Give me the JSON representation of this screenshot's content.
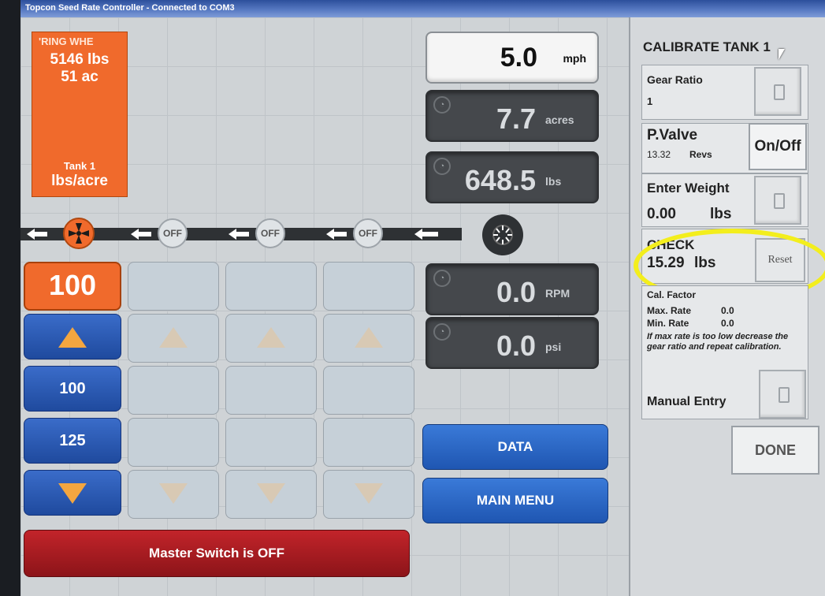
{
  "window": {
    "title": "Topcon Seed Rate Controller - Connected to COM3"
  },
  "tank": {
    "name": "'RING WHE",
    "weight": "5146 lbs",
    "area": "51 ac",
    "tank_label": "Tank 1",
    "unit": "lbs/acre"
  },
  "readouts": {
    "speed": {
      "value": "5.0",
      "unit": "mph"
    },
    "acres": {
      "value": "7.7",
      "unit": "acres"
    },
    "lbs": {
      "value": "648.5",
      "unit": "lbs"
    },
    "rpm": {
      "value": "0.0",
      "unit": "RPM"
    },
    "psi": {
      "value": "0.0",
      "unit": "psi"
    }
  },
  "sections": {
    "off_labels": [
      "OFF",
      "OFF",
      "OFF"
    ]
  },
  "rate": {
    "current": "100",
    "preset1": "100",
    "preset2": "125"
  },
  "buttons": {
    "data": "DATA",
    "main_menu": "MAIN MENU",
    "master": "Master Switch is OFF"
  },
  "calibrate": {
    "title": "CALIBRATE TANK 1",
    "gear_ratio_label": "Gear Ratio",
    "gear_ratio_value": "1",
    "pvalve_label": "P.Valve",
    "pvalve_revs": "13.32",
    "pvalve_revs_unit": "Revs",
    "onoff": "On/Off",
    "enter_weight_label": "Enter Weight",
    "enter_weight_value": "0.00",
    "enter_weight_unit": "lbs",
    "check_label": "CHECK",
    "check_value": "15.29",
    "check_unit": "lbs",
    "reset": "Reset",
    "cal_factor_label": "Cal. Factor",
    "max_rate_label": "Max. Rate",
    "max_rate_value": "0.0",
    "min_rate_label": "Min. Rate",
    "min_rate_value": "0.0",
    "hint": "If max rate is too low decrease the gear ratio and repeat calibration.",
    "manual_entry": "Manual Entry",
    "done": "DONE"
  },
  "colors": {
    "accent_orange": "#f06a2c",
    "button_blue": "#2a5fbf",
    "master_red": "#b01c22",
    "highlight": "#f3ee1d"
  }
}
